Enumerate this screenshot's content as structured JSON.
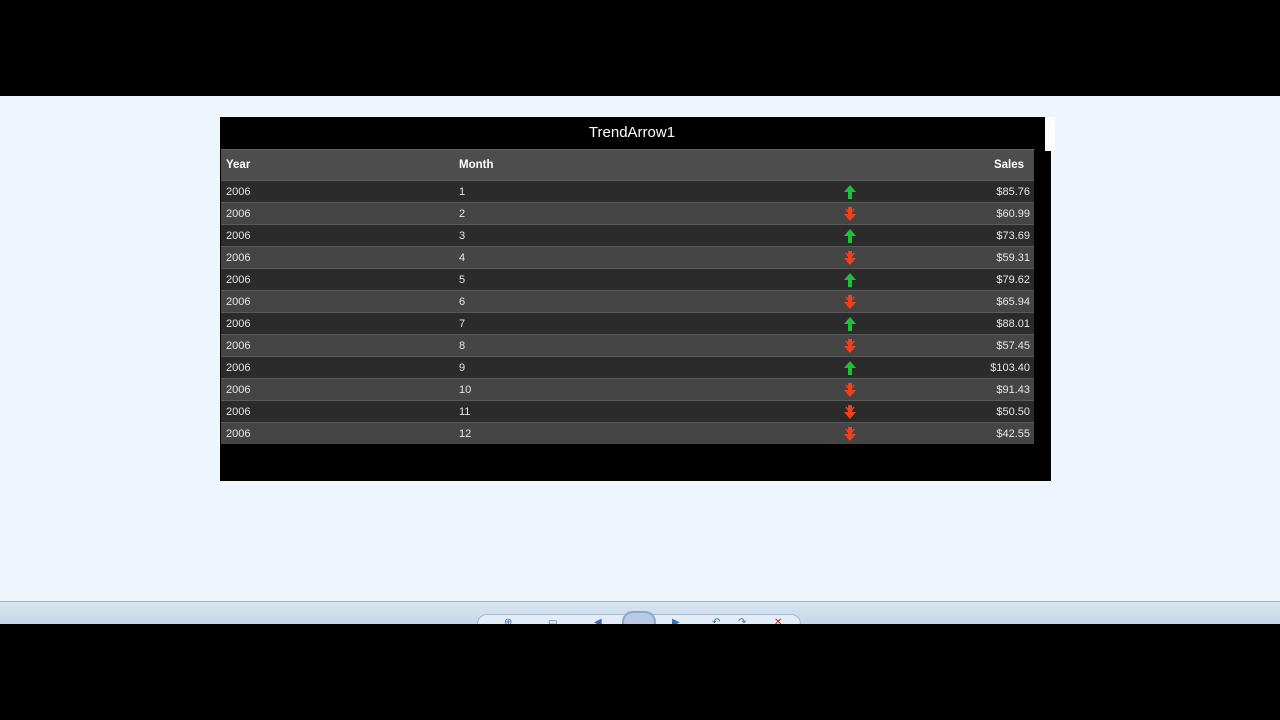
{
  "widget": {
    "title": "TrendArrow1",
    "columns": {
      "year": "Year",
      "month": "Month",
      "trend": "",
      "sales": "Sales"
    },
    "colors": {
      "up": "#1fbf3a",
      "down": "#f0401b"
    },
    "rows": [
      {
        "year": "2006",
        "month": "1",
        "trend": "up",
        "sales": "$85.76"
      },
      {
        "year": "2006",
        "month": "2",
        "trend": "down",
        "sales": "$60.99"
      },
      {
        "year": "2006",
        "month": "3",
        "trend": "up",
        "sales": "$73.69"
      },
      {
        "year": "2006",
        "month": "4",
        "trend": "down",
        "sales": "$59.31"
      },
      {
        "year": "2006",
        "month": "5",
        "trend": "up",
        "sales": "$79.62"
      },
      {
        "year": "2006",
        "month": "6",
        "trend": "down",
        "sales": "$65.94"
      },
      {
        "year": "2006",
        "month": "7",
        "trend": "up",
        "sales": "$88.01"
      },
      {
        "year": "2006",
        "month": "8",
        "trend": "down",
        "sales": "$57.45"
      },
      {
        "year": "2006",
        "month": "9",
        "trend": "up",
        "sales": "$103.40"
      },
      {
        "year": "2006",
        "month": "10",
        "trend": "down",
        "sales": "$91.43"
      },
      {
        "year": "2006",
        "month": "11",
        "trend": "down",
        "sales": "$50.50"
      },
      {
        "year": "2006",
        "month": "12",
        "trend": "down",
        "sales": "$42.55"
      }
    ]
  },
  "taskbar": {
    "icons": [
      "zoom-icon",
      "fit-icon",
      "first-page-icon",
      "slideshow-icon",
      "last-page-icon",
      "rotate-left-icon",
      "rotate-right-icon",
      "delete-icon"
    ]
  }
}
